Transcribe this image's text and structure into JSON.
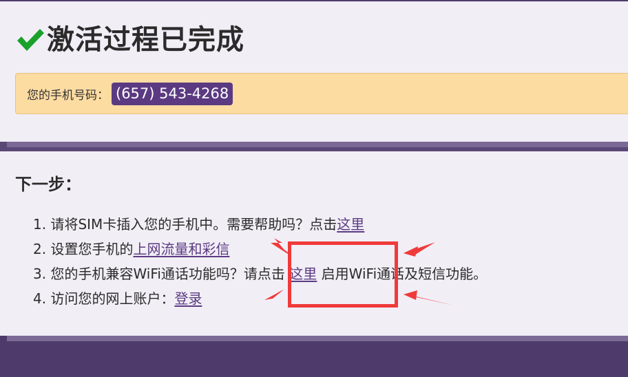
{
  "header": {
    "title": "激活过程已完成",
    "check_icon": "checkmark-icon",
    "check_color": "#1aa12a"
  },
  "phone": {
    "label": "您的手机号码：",
    "number": "(657) 543-4268"
  },
  "next_steps": {
    "heading": "下一步：",
    "items": [
      {
        "prefix": "1. 请将SIM卡插入您的手机中。需要帮助吗？点击",
        "link": "这里",
        "suffix": ""
      },
      {
        "prefix": "2. 设置您手机的",
        "link": "上网流量和彩信",
        "suffix": ""
      },
      {
        "prefix": "3. 您的手机兼容WiFi通话功能吗？请点击 ",
        "link": "这里",
        "suffix": " 启用WiFi通话及短信功能。"
      },
      {
        "prefix": "4. 访问您的网上账户：",
        "link": "登录",
        "suffix": ""
      }
    ]
  },
  "colors": {
    "accent": "#5b3a82",
    "band": "#4e3b6b",
    "notice_bg": "#fddca2",
    "annotation_red": "#f03a3a"
  }
}
